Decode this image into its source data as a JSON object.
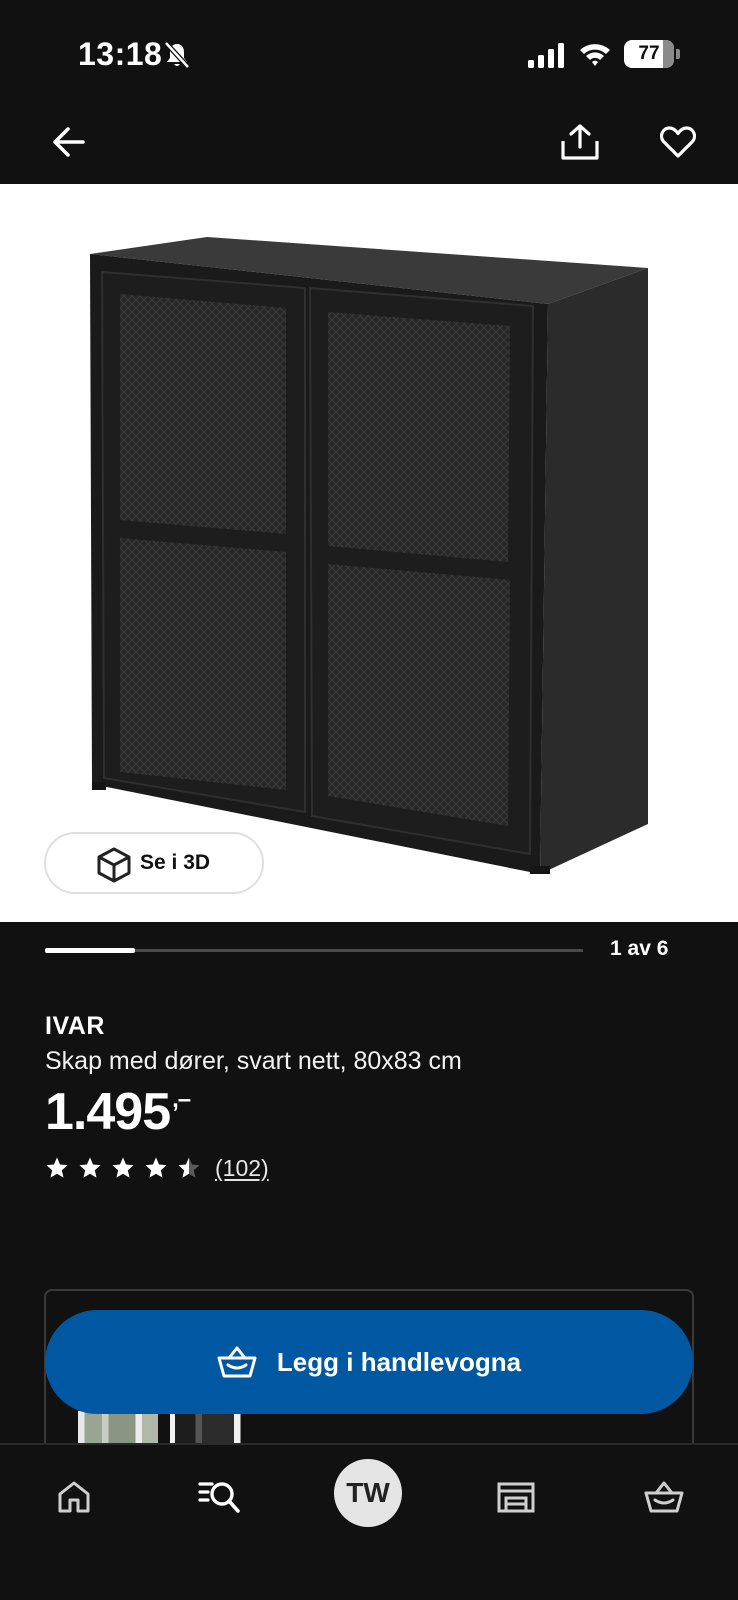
{
  "status_bar": {
    "time": "13:18",
    "battery": "77",
    "icons": [
      "bell-slash-icon",
      "signal-icon",
      "wifi-icon",
      "battery-icon"
    ]
  },
  "top_nav": {
    "icons": [
      "back-arrow-icon",
      "share-icon",
      "heart-icon"
    ]
  },
  "gallery": {
    "see_3d_label": "Se i 3D",
    "pager_text": "1 av 6",
    "current_index": 1,
    "total": 6
  },
  "product": {
    "name": "IVAR",
    "description": "Skap med dører, svart nett, 80x83 cm",
    "price": "1.495",
    "price_suffix": ",–",
    "rating": 4.5,
    "rating_max": 5,
    "review_count": "(102)"
  },
  "cta": {
    "label": "Legg i handlevogna",
    "color": "#0058a3"
  },
  "bottom_nav": {
    "profile_initials": "TW",
    "items": [
      "home-icon",
      "search-list-icon",
      "profile-avatar",
      "store-icon",
      "basket-icon"
    ]
  }
}
